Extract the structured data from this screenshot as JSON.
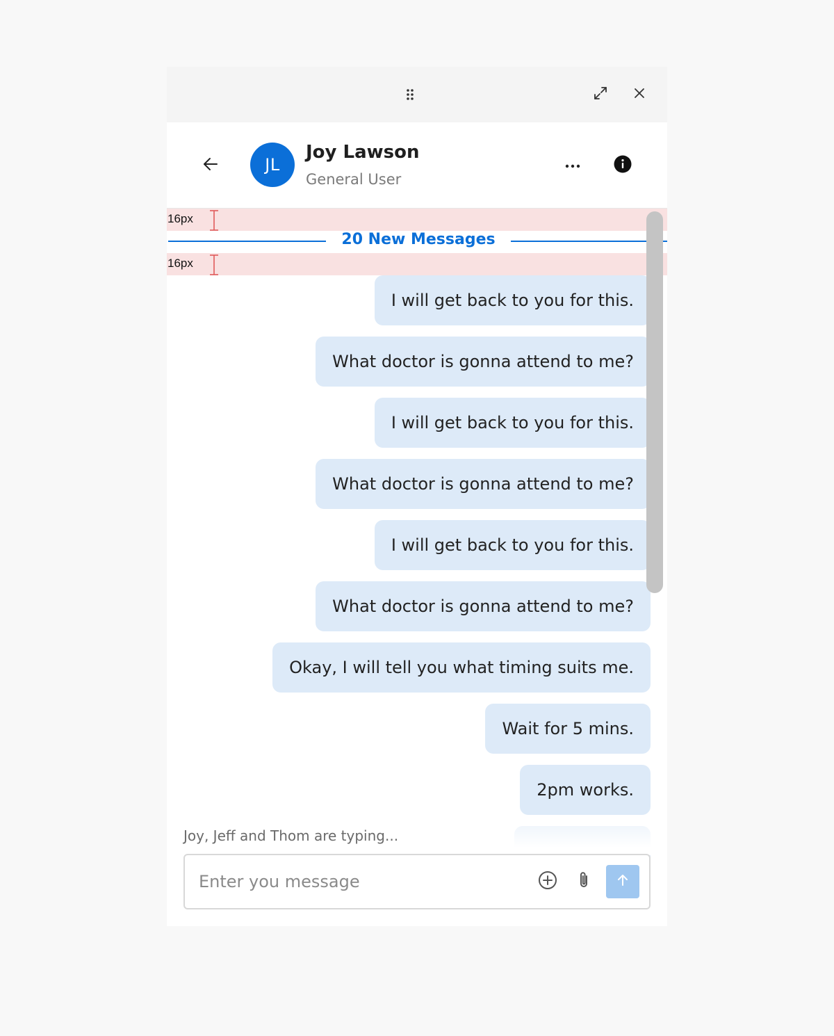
{
  "window": {
    "drag_icon": "drag-handle-icon",
    "expand_icon": "expand-icon",
    "close_icon": "close-icon"
  },
  "header": {
    "back_icon": "arrow-left-icon",
    "avatar_initials": "JL",
    "name": "Joy Lawson",
    "role": "General User",
    "more_icon": "more-horizontal-icon",
    "info_icon": "info-icon"
  },
  "spacing_annotations": [
    "16px",
    "16px"
  ],
  "divider": {
    "label": "20 New Messages"
  },
  "messages": [
    "I will get back to you for this.",
    "What doctor is gonna attend to me?",
    "I will get back to you for this.",
    "What doctor is gonna attend to me?",
    "I will get back to you for this.",
    "What doctor is gonna attend to me?",
    "Okay, I will tell you what timing suits me.",
    "Wait for 5 mins.",
    "2pm works."
  ],
  "typing_indicator": "Joy, Jeff and Thom are typing...",
  "composer": {
    "placeholder": "Enter you message",
    "value": "",
    "add_icon": "plus-circle-icon",
    "attach_icon": "paperclip-icon",
    "send_icon": "arrow-up-icon"
  },
  "colors": {
    "page_background": "#f8f8f8",
    "topbar_background": "#f4f4f4",
    "accent": "#0b6fd8",
    "bubble": "#ddeaf8",
    "spacer_highlight": "#f9e1e1",
    "send_button": "#9fc7f0",
    "scrollbar": "#c4c4c4"
  }
}
